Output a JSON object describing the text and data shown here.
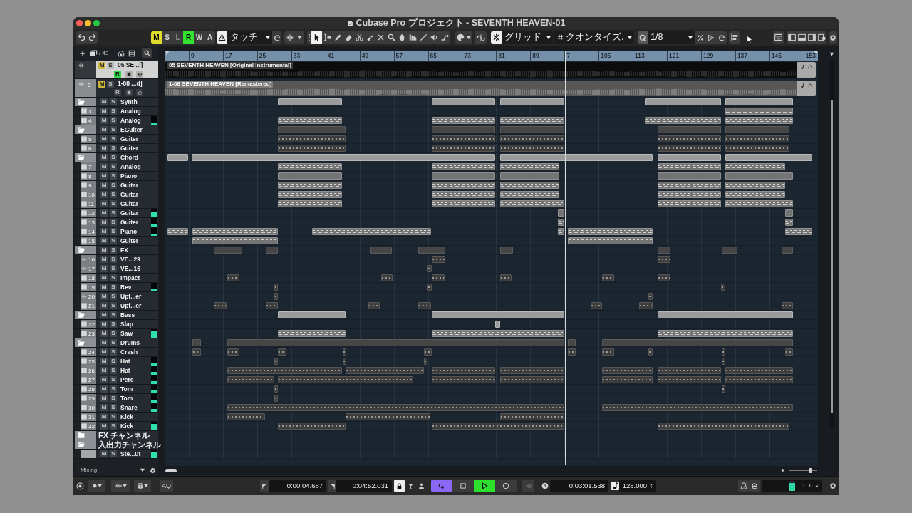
{
  "window": {
    "title": "Cubase Pro プロジェクト - SEVENTH HEAVEN-01"
  },
  "toolbar": {
    "automation": {
      "buttons": [
        {
          "kind": "mute",
          "label": "M",
          "on": true,
          "disabled": false
        },
        {
          "kind": "solo",
          "label": "S",
          "on": false,
          "disabled": false
        },
        {
          "kind": "listen",
          "label": "L",
          "on": false,
          "disabled": true
        },
        {
          "kind": "read",
          "label": "R",
          "on": true,
          "disabled": false
        },
        {
          "kind": "write",
          "label": "W",
          "on": false,
          "disabled": false
        },
        {
          "kind": "automation",
          "label": "A",
          "on": false,
          "disabled": false
        }
      ],
      "mode": "タッチ"
    },
    "tools": [
      {
        "kind": "select",
        "selected": true
      },
      {
        "kind": "range",
        "selected": false
      },
      {
        "kind": "pencil",
        "selected": false
      },
      {
        "kind": "eraser",
        "selected": false
      },
      {
        "kind": "scissors",
        "selected": false
      },
      {
        "kind": "glue",
        "selected": false
      },
      {
        "kind": "mute",
        "selected": false
      },
      {
        "kind": "zoom",
        "selected": false
      },
      {
        "kind": "hand",
        "selected": false
      },
      {
        "kind": "comp",
        "selected": false
      },
      {
        "kind": "line",
        "selected": false
      },
      {
        "kind": "play",
        "selected": false
      },
      {
        "kind": "warp",
        "selected": false
      }
    ],
    "snap": {
      "on": true,
      "type": "グリッド"
    },
    "quantize": {
      "type": "クオンタイズ.",
      "value": "1/8"
    }
  },
  "track_list": {
    "count": "/ 43",
    "footer": "Mixing"
  },
  "ruler": {
    "bars": [
      "9",
      "17",
      "25",
      "33",
      "41",
      "49",
      "57",
      "65",
      "73",
      "81",
      "89",
      "7",
      "105",
      "113",
      "121",
      "129",
      "137",
      "145",
      "153"
    ]
  },
  "tracks": [
    {
      "kind": "audio",
      "name": "05 SE...l]",
      "buttons": [
        "M",
        "S"
      ],
      "muted": true,
      "selected": true,
      "read": true,
      "read_label": "R",
      "event": {
        "name": "05 SEVENTH HEAVEN [Original Instrumental]",
        "selected": true
      }
    },
    {
      "kind": "audio",
      "number": "2",
      "name": "1-08 ...d]",
      "buttons": [
        "M",
        "S"
      ],
      "muted": true,
      "selected": false,
      "read": false,
      "read_label": "R",
      "event": {
        "name": "1-08 SEVENTH HEAVEN [Remastered]",
        "selected": false
      }
    },
    {
      "kind": "folder",
      "name": "Synth",
      "buttons": [
        "M",
        "S"
      ],
      "muted": false,
      "selected": false,
      "expanded": true,
      "children": [
        {
          "kind": "instrument",
          "number": "3",
          "name": "Analog",
          "buttons": [
            "M",
            "S"
          ],
          "muted": false,
          "selected": false
        },
        {
          "kind": "instrument",
          "number": "4",
          "name": "Analog",
          "buttons": [
            "M",
            "S"
          ],
          "muted": false,
          "selected": false,
          "level": 0.25
        }
      ]
    },
    {
      "kind": "folder",
      "name": "EGuiter",
      "buttons": [
        "M",
        "S"
      ],
      "muted": false,
      "selected": false,
      "expanded": true,
      "children": [
        {
          "kind": "instrument",
          "number": "5",
          "name": "Guiter",
          "buttons": [
            "M",
            "S"
          ],
          "muted": false,
          "selected": false
        },
        {
          "kind": "instrument",
          "number": "6",
          "name": "Guiter",
          "buttons": [
            "M",
            "S"
          ],
          "muted": false,
          "selected": false
        }
      ]
    },
    {
      "kind": "folder",
      "name": "Chord",
      "buttons": [
        "M",
        "S"
      ],
      "muted": false,
      "selected": false,
      "expanded": true,
      "children": [
        {
          "kind": "instrument",
          "number": "7",
          "name": "Analog",
          "buttons": [
            "M",
            "S"
          ],
          "muted": false,
          "selected": false
        },
        {
          "kind": "instrument",
          "number": "8",
          "name": "Piano",
          "buttons": [
            "M",
            "S"
          ],
          "muted": false,
          "selected": false
        },
        {
          "kind": "instrument",
          "number": "9",
          "name": "Guitar",
          "buttons": [
            "M",
            "S"
          ],
          "muted": false,
          "selected": false
        },
        {
          "kind": "instrument",
          "number": "10",
          "name": "Guitar",
          "buttons": [
            "M",
            "S"
          ],
          "muted": false,
          "selected": false
        },
        {
          "kind": "instrument",
          "number": "11",
          "name": "Guitar",
          "buttons": [
            "M",
            "S"
          ],
          "muted": false,
          "selected": false
        },
        {
          "kind": "instrument",
          "number": "12",
          "name": "Guitar",
          "buttons": [
            "M",
            "S"
          ],
          "muted": false,
          "selected": false,
          "level": 0.58
        },
        {
          "kind": "instrument",
          "number": "13",
          "name": "Guiter",
          "buttons": [
            "M",
            "S"
          ],
          "muted": false,
          "selected": false,
          "level": 0.25
        },
        {
          "kind": "instrument",
          "number": "14",
          "name": "Piano",
          "buttons": [
            "M",
            "S"
          ],
          "muted": false,
          "selected": false,
          "level": 0.25
        },
        {
          "kind": "instrument",
          "number": "15",
          "name": "Guiter",
          "buttons": [
            "M",
            "S"
          ],
          "muted": false,
          "selected": false
        }
      ]
    },
    {
      "kind": "folder",
      "name": "FX",
      "buttons": [
        "M",
        "S"
      ],
      "muted": false,
      "selected": false,
      "expanded": true,
      "children": [
        {
          "kind": "audio",
          "number": "16",
          "name": "VE...29",
          "buttons": [
            "M",
            "S"
          ],
          "muted": false,
          "selected": false
        },
        {
          "kind": "audio",
          "number": "17",
          "name": "VE...16",
          "buttons": [
            "M",
            "S"
          ],
          "muted": false,
          "selected": false
        },
        {
          "kind": "instrument",
          "number": "18",
          "name": "Impact",
          "buttons": [
            "M",
            "S"
          ],
          "muted": false,
          "selected": false
        },
        {
          "kind": "instrument",
          "number": "19",
          "name": "Rev",
          "buttons": [
            "M",
            "S"
          ],
          "muted": false,
          "selected": false,
          "level": 0.33
        },
        {
          "kind": "audio",
          "number": "20",
          "name": "Upf...er",
          "buttons": [
            "M",
            "S"
          ],
          "muted": false,
          "selected": false
        },
        {
          "kind": "instrument",
          "number": "21",
          "name": "Upf...er",
          "buttons": [
            "M",
            "S"
          ],
          "muted": false,
          "selected": false
        }
      ]
    },
    {
      "kind": "folder",
      "name": "Bass",
      "buttons": [
        "M",
        "S"
      ],
      "muted": false,
      "selected": false,
      "expanded": true,
      "children": [
        {
          "kind": "instrument",
          "number": "22",
          "name": "Slap",
          "buttons": [
            "M",
            "S"
          ],
          "muted": false,
          "selected": false
        },
        {
          "kind": "instrument",
          "number": "23",
          "name": "Saw",
          "buttons": [
            "M",
            "S"
          ],
          "muted": false,
          "selected": false,
          "level": 0.75
        }
      ]
    },
    {
      "kind": "folder",
      "name": "Drums",
      "buttons": [
        "M",
        "S"
      ],
      "muted": false,
      "selected": false,
      "expanded": true,
      "children": [
        {
          "kind": "instrument",
          "number": "24",
          "name": "Crash",
          "buttons": [
            "M",
            "S"
          ],
          "muted": false,
          "selected": false
        },
        {
          "kind": "instrument",
          "number": "25",
          "name": "Hat",
          "buttons": [
            "M",
            "S"
          ],
          "muted": false,
          "selected": false,
          "level": 0.33
        },
        {
          "kind": "instrument",
          "number": "26",
          "name": "Hat",
          "buttons": [
            "M",
            "S"
          ],
          "muted": false,
          "selected": false,
          "level": 0.33
        },
        {
          "kind": "instrument",
          "number": "27",
          "name": "Perc",
          "buttons": [
            "M",
            "S"
          ],
          "muted": false,
          "selected": false,
          "level": 0.33
        },
        {
          "kind": "instrument",
          "number": "28",
          "name": "Tom",
          "buttons": [
            "M",
            "S"
          ],
          "muted": false,
          "selected": false,
          "level": 0.42
        },
        {
          "kind": "instrument",
          "number": "29",
          "name": "Tom",
          "buttons": [
            "M",
            "S"
          ],
          "muted": false,
          "selected": false,
          "level": 0.25
        },
        {
          "kind": "instrument",
          "number": "30",
          "name": "Snare",
          "buttons": [
            "M",
            "S"
          ],
          "muted": false,
          "selected": false,
          "level": 0.33
        },
        {
          "kind": "instrument",
          "number": "31",
          "name": "Kick",
          "buttons": [
            "M",
            "S"
          ],
          "muted": false,
          "selected": false
        },
        {
          "kind": "instrument",
          "number": "32",
          "name": "Kick",
          "buttons": [
            "M",
            "S"
          ],
          "muted": false,
          "selected": false,
          "level": 0.75
        }
      ]
    },
    {
      "kind": "folder",
      "name": "FX チャンネル",
      "selected": false,
      "expanded": false
    },
    {
      "kind": "folder",
      "name": "入出力チャンネル",
      "selected": false,
      "expanded": true,
      "children": [
        {
          "kind": "output",
          "name": "Ste...ut",
          "buttons": [
            "M",
            "S"
          ],
          "muted": false,
          "selected": false,
          "level": 0.75
        }
      ]
    }
  ],
  "zoom": {
    "level": 0.78
  },
  "transport": {
    "aq": "AQ",
    "left_locator": "0:00:04.687",
    "right_locator": "0:04:52.031",
    "buttons": [
      {
        "kind": "cycle",
        "on": true
      },
      {
        "kind": "stop",
        "on": false
      },
      {
        "kind": "play",
        "on": true
      },
      {
        "kind": "record",
        "on": false
      }
    ],
    "position": "0:03:01.538",
    "tempo": "128.000",
    "output": {
      "level": 0.8,
      "reading": "0.00"
    }
  }
}
